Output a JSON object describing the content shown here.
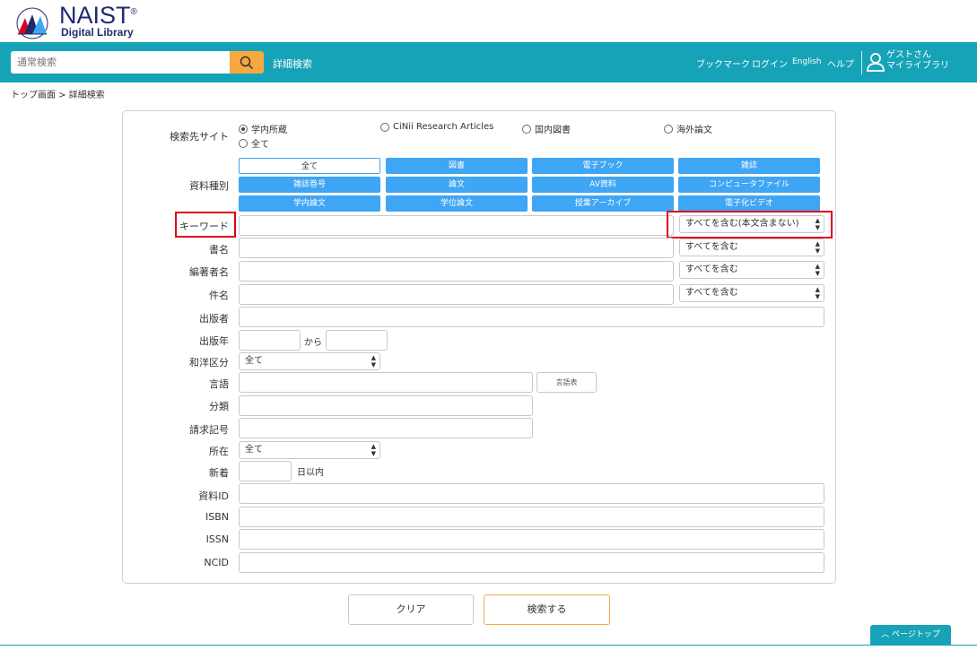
{
  "logo": {
    "name": "NAIST",
    "registered": "®",
    "subtitle": "Digital Library",
    "seal_text": "Institute of Science and Tech · NAIST"
  },
  "header": {
    "search_placeholder": "通常検索",
    "advanced_search": "詳細検索",
    "nav": [
      "ブックマーク",
      "ログイン",
      "English",
      "ヘルプ"
    ],
    "user_line1": "ゲストさん",
    "user_line2": "マイライブラリ"
  },
  "breadcrumb": "トップ画面 > 詳細検索",
  "form": {
    "site_label": "検索先サイト",
    "sites": [
      {
        "label": "学内所蔵",
        "checked": true
      },
      {
        "label": "CiNii Research Articles",
        "checked": false
      },
      {
        "label": "国内図書",
        "checked": false
      },
      {
        "label": "海外論文",
        "checked": false
      },
      {
        "label": "全て",
        "checked": false
      }
    ],
    "material_label": "資料種別",
    "material_types": [
      "全て",
      "図書",
      "電子ブック",
      "雑誌",
      "雑誌巻号",
      "論文",
      "AV資料",
      "コンピュータファイル",
      "学内論文",
      "学位論文",
      "授業アーカイブ",
      "電子化ビデオ"
    ],
    "selected_material": "全て",
    "labels": {
      "keyword": "キーワード",
      "title": "書名",
      "author": "編著者名",
      "subject": "件名",
      "publisher": "出版者",
      "year": "出版年",
      "jp_foreign": "和洋区分",
      "language": "言語",
      "classification": "分類",
      "call_number": "請求記号",
      "location": "所在",
      "new_arrival": "新着",
      "material_id": "資料ID",
      "isbn": "ISBN",
      "issn": "ISSN",
      "ncid": "NCID"
    },
    "keyword_mode": "すべてを含む(本文含まない)",
    "title_mode": "すべてを含む",
    "author_mode": "すべてを含む",
    "subject_mode": "すべてを含む",
    "year_to": "から",
    "jp_foreign_value": "全て",
    "language_table_btn": "言語表",
    "location_value": "全て",
    "new_arrival_suffix": "日以内"
  },
  "actions": {
    "clear": "クリア",
    "search": "検索する"
  },
  "page_top": "ページトップ",
  "colors": {
    "brand": "#16a3b8",
    "accent": "#f7a93f",
    "button_blue": "#3fa5f5",
    "highlight": "#e0001b"
  }
}
